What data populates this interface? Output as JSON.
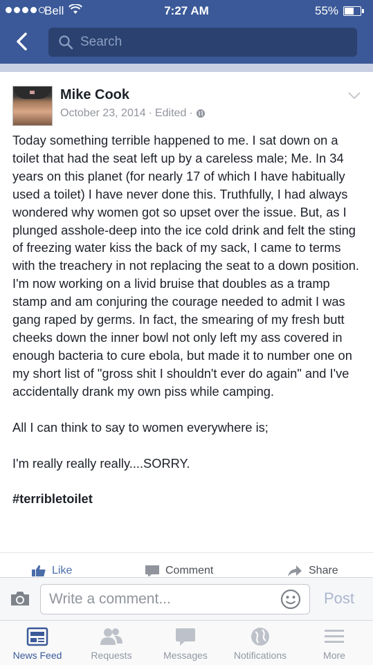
{
  "status": {
    "carrier": "Bell",
    "time": "7:27 AM",
    "battery_pct": "55%",
    "battery_level": 0.55,
    "signal_bars_filled": 4,
    "signal_bars_total": 5
  },
  "nav": {
    "search_placeholder": "Search",
    "back_icon": "chevron-left-icon"
  },
  "post": {
    "author": "Mike Cook",
    "date": "October 23, 2014",
    "edited": "Edited",
    "separator": "·",
    "audience_icon": "globe-icon",
    "body": [
      "Today something terrible happened to me. I sat down on a toilet that had the seat left up by a careless male; Me. In 34 years on this planet (for nearly 17 of which I have habitually used a toilet) I have never done this. Truthfully, I had always wondered why women got so upset over the issue. But, as I plunged asshole-deep into the ice cold drink and felt the sting of freezing water kiss the back of my sack, I came to terms with the treachery in not replacing the seat to a down position. I'm now working on a livid bruise that doubles as a tramp stamp and am conjuring the courage needed to admit I was gang raped by germs. In fact, the smearing of my fresh butt cheeks down the inner bowl not only left my ass covered in enough bacteria to cure ebola, but made it to number one on my short list of \"gross shit I shouldn't ever do again\" and I've accidentally drank my own piss while camping.",
      "All I can think to say to women everywhere is;",
      "I'm really really really....SORRY."
    ],
    "hashtag": "#terribletoilet",
    "actions": {
      "like": "Like",
      "comment": "Comment",
      "share": "Share"
    }
  },
  "comment_bar": {
    "placeholder": "Write a comment...",
    "post_label": "Post"
  },
  "tabs": [
    {
      "label": "News Feed",
      "icon": "news-feed-icon",
      "active": true
    },
    {
      "label": "Requests",
      "icon": "friend-requests-icon",
      "active": false
    },
    {
      "label": "Messages",
      "icon": "messages-icon",
      "active": false
    },
    {
      "label": "Notifications",
      "icon": "globe-icon",
      "active": false
    },
    {
      "label": "More",
      "icon": "menu-icon",
      "active": false
    }
  ],
  "colors": {
    "brand": "#3b5998",
    "link": "#4b6ea9",
    "muted": "#90949c"
  }
}
